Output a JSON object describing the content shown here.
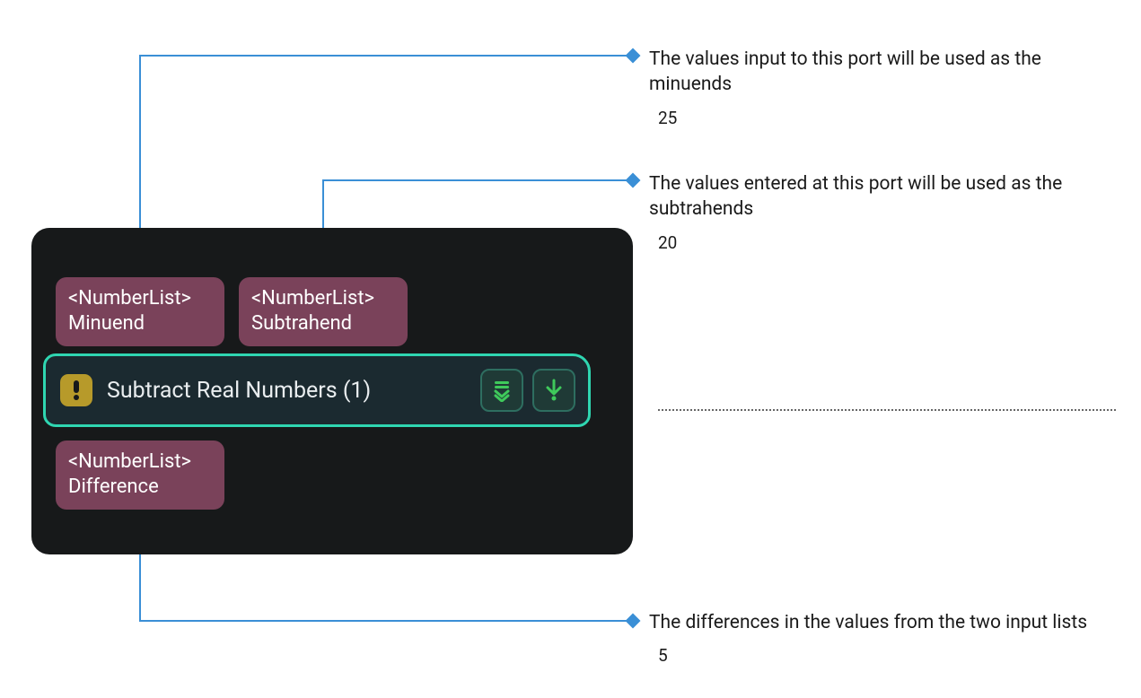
{
  "node": {
    "title": "Subtract Real Numbers (1)",
    "warning_icon": "exclamation-icon",
    "actions": {
      "expand_all": "expand-all-icon",
      "run_down": "arrow-down-icon"
    },
    "ports": {
      "minuend": {
        "type": "<NumberList>",
        "name": "Minuend"
      },
      "subtrahend": {
        "type": "<NumberList>",
        "name": "Subtrahend"
      },
      "difference": {
        "type": "<NumberList>",
        "name": "Difference"
      }
    }
  },
  "annotations": {
    "minuend": {
      "text": "The values input to this port will be used as the minuends",
      "value": "25"
    },
    "subtrahend": {
      "text": "The values entered at this port will be used as the subtrahends",
      "value": "20"
    },
    "difference": {
      "text": "The differences in the values from the two input lists",
      "value": "5"
    }
  },
  "colors": {
    "panel_bg": "#17191a",
    "port_bg": "#7a425a",
    "titlebar_border": "#2fd6b1",
    "connector": "#3a8fd6",
    "action_green": "#3fc95b"
  }
}
